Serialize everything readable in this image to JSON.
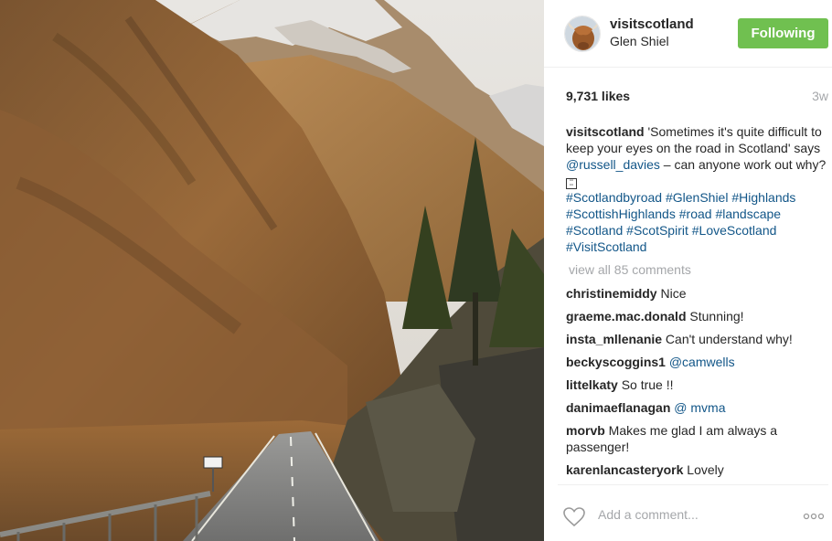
{
  "post": {
    "image_alt": "Road winding through Glen Shiel valley"
  },
  "header": {
    "avatar_icon": "highland-cow-avatar-icon",
    "username": "visitscotland",
    "location": "Glen Shiel",
    "follow_label": "Following",
    "follow_color": "#70c050"
  },
  "stats": {
    "likes": "9,731 likes",
    "time": "3w"
  },
  "caption": {
    "user": "visitscotland",
    "text_1": " 'Sometimes it's quite difficult to keep your eyes on the road in Scotland' says ",
    "mention": "@russell_davies",
    "text_2": " – can anyone work out why? ",
    "emoji_icon": "road-sign-emoji-icon",
    "tags": [
      "#Scotlandbyroad",
      "#GlenShiel",
      "#Highlands",
      "#ScottishHighlands",
      "#road",
      "#landscape",
      "#Scotland",
      "#ScotSpirit",
      "#LoveScotland",
      "#VisitScotland"
    ]
  },
  "view_all": "view all 85 comments",
  "comments": [
    {
      "user": "christinemiddy",
      "text": " Nice"
    },
    {
      "user": "graeme.mac.donald",
      "text": " Stunning!"
    },
    {
      "user": "insta_mllenanie",
      "text": " Can't understand why!"
    },
    {
      "user": "beckyscoggins1",
      "text": " ",
      "mention": "@camwells"
    },
    {
      "user": "littelkaty",
      "text": " So true !!"
    },
    {
      "user": "danimaeflanagan",
      "text": " ",
      "mention": "@ mvma"
    },
    {
      "user": "morvb",
      "text": " Makes me glad I am always a passenger!"
    },
    {
      "user": "karenlancasteryork",
      "text": " Lovely"
    }
  ],
  "footer": {
    "heart_icon": "heart-icon",
    "add_comment_placeholder": "Add a comment...",
    "more_icon": "more-options-icon"
  },
  "colors": {
    "link": "#125688",
    "muted": "#a5a7aa",
    "text": "#262626"
  }
}
